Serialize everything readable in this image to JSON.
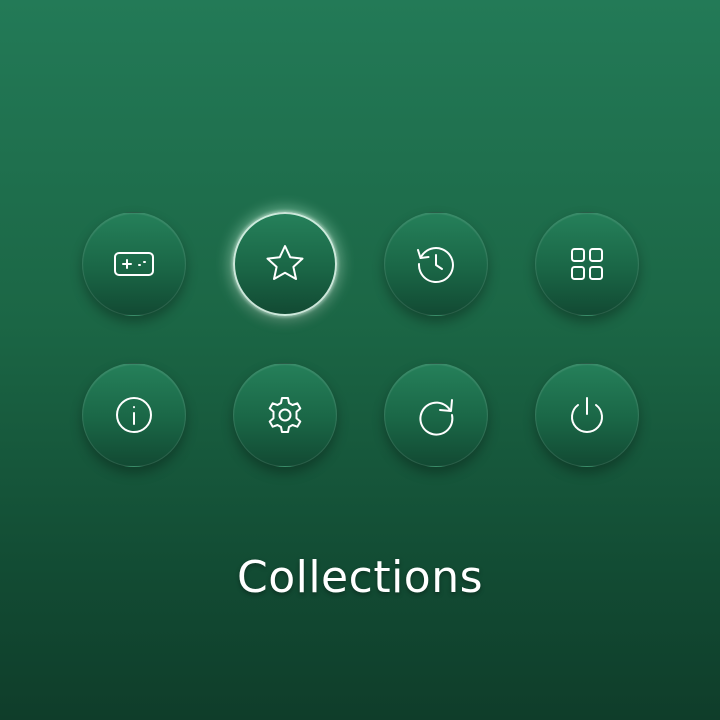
{
  "menu": {
    "buttons": [
      {
        "id": "games",
        "icon": "gamepad-icon",
        "selected": false
      },
      {
        "id": "favorites",
        "icon": "star-icon",
        "selected": true
      },
      {
        "id": "history",
        "icon": "history-icon",
        "selected": false
      },
      {
        "id": "apps",
        "icon": "grid-icon",
        "selected": false
      },
      {
        "id": "info",
        "icon": "info-icon",
        "selected": false
      },
      {
        "id": "settings",
        "icon": "gear-icon",
        "selected": false
      },
      {
        "id": "refresh",
        "icon": "refresh-icon",
        "selected": false
      },
      {
        "id": "power",
        "icon": "power-icon",
        "selected": false
      }
    ],
    "selected_label": "Collections"
  },
  "colors": {
    "background_top": "#237a57",
    "background_bottom": "#0f3d2a",
    "icon": "#ffffff",
    "selection_glow": "#c8ffe1"
  }
}
